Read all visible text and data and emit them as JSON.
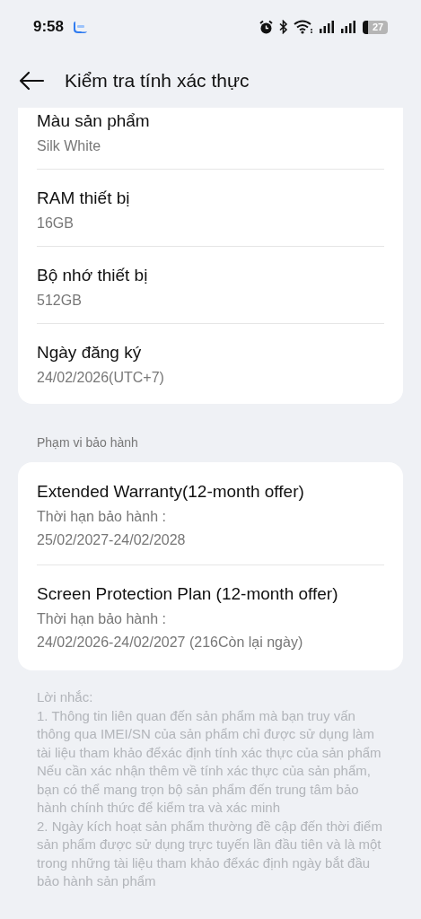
{
  "status_bar": {
    "time": "9:58",
    "battery": "27"
  },
  "header": {
    "title": "Kiểm tra tính xác thực"
  },
  "product_info": [
    {
      "label": "Màu sản phẩm",
      "value": "Silk White"
    },
    {
      "label": "RAM thiết bị",
      "value": "16GB"
    },
    {
      "label": "Bộ nhớ thiết bị",
      "value": "512GB"
    },
    {
      "label": "Ngày đăng ký",
      "value": "24/02/2026(UTC+7)"
    }
  ],
  "warranty": {
    "section_title": "Phạm vi bảo hành",
    "items": [
      {
        "name": "Extended Warranty(12-month offer)",
        "term_label": "Thời hạn bảo hành :",
        "term": "25/02/2027-24/02/2028"
      },
      {
        "name": "Screen Protection Plan (12-month offer)",
        "term_label": "Thời hạn bảo hành :",
        "term": "24/02/2026-24/02/2027 (216Còn lại ngày)"
      }
    ]
  },
  "notes": {
    "title": "Lời nhắc:",
    "items": [
      "1. Thông tin liên quan đến sản phẩm mà bạn truy vấn thông qua IMEI/SN của sản phẩm chỉ được sử dụng làm tài liệu tham khảo đểxác định tính xác thực của sản phẩm Nếu cần xác nhận thêm về tính xác thực của sản phẩm, bạn có thể mang trọn bộ sản phẩm đến trung tâm bảo hành chính thức để kiểm tra và xác minh",
      "2. Ngày kích hoạt sản phẩm thường đề cập đến thời điểm sản phẩm được sử dụng trực tuyến lần đầu tiên và là một trong những tài liệu tham khảo đểxác định ngày bắt đầu bảo hành sản phẩm"
    ]
  }
}
